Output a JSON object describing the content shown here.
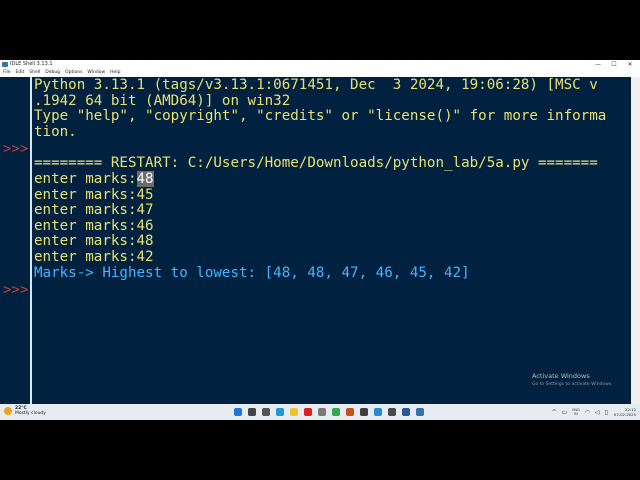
{
  "window": {
    "title": "IDLE Shell 3.13.1",
    "controls": {
      "minimize": "—",
      "maximize": "☐",
      "close": "✕"
    }
  },
  "menu": [
    "File",
    "Edit",
    "Shell",
    "Debug",
    "Options",
    "Window",
    "Help"
  ],
  "shell": {
    "prompt": ">>>",
    "banner": [
      "Python 3.13.1 (tags/v3.13.1:0671451, Dec  3 2024, 19:06:28) [MSC v",
      ".1942 64 bit (AMD64)] on win32",
      "Type \"help\", \"copyright\", \"credits\" or \"license()\" for more informa",
      "tion."
    ],
    "restart": "======== RESTART: C:/Users/Home/Downloads/python_lab/5a.py =======",
    "inputs": [
      {
        "label": "enter marks:",
        "value": "48"
      },
      {
        "label": "enter marks:",
        "value": "45"
      },
      {
        "label": "enter marks:",
        "value": "47"
      },
      {
        "label": "enter marks:",
        "value": "46"
      },
      {
        "label": "enter marks:",
        "value": "48"
      },
      {
        "label": "enter marks:",
        "value": "42"
      }
    ],
    "result": "Marks-> Highest to lowest: [48, 48, 47, 46, 45, 42]"
  },
  "activation": {
    "title": "Activate Windows",
    "subtitle": "Go to Settings to activate Windows."
  },
  "taskbar": {
    "weather_temp": "22°C",
    "weather_desc": "Mostly cloudy",
    "apps": [
      {
        "name": "start",
        "color": "#1e78d7"
      },
      {
        "name": "search",
        "color": "#444444"
      },
      {
        "name": "task-view",
        "color": "#555555"
      },
      {
        "name": "edge",
        "color": "#1f9ad6"
      },
      {
        "name": "file-explorer",
        "color": "#f2c12e"
      },
      {
        "name": "youtube",
        "color": "#e02020"
      },
      {
        "name": "app-7",
        "color": "#7a7a7a"
      },
      {
        "name": "chrome",
        "color": "#34a853"
      },
      {
        "name": "app-9",
        "color": "#c94f1e"
      },
      {
        "name": "app-10",
        "color": "#3d3d3d"
      },
      {
        "name": "vscode",
        "color": "#2a88d6"
      },
      {
        "name": "app-12",
        "color": "#4a4a4a"
      },
      {
        "name": "word",
        "color": "#2b579a"
      },
      {
        "name": "idle",
        "color": "#3572a5"
      }
    ],
    "lang_1": "ENG",
    "lang_2": "IN",
    "time": "22:12",
    "date": "07-02-2025"
  },
  "colors": {
    "shell_bg": "#002240",
    "text": "#e9e072",
    "result": "#45b4ff",
    "prompt": "#c13e3e"
  }
}
